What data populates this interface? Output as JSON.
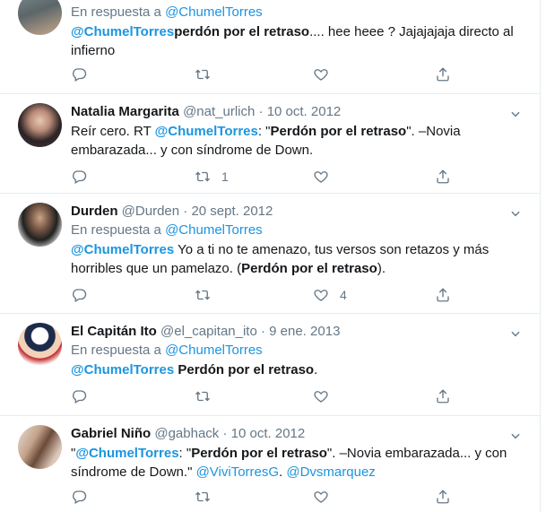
{
  "tweets": [
    {
      "reply_prefix": "En respuesta a",
      "reply_to": "@ChumelTorres",
      "mention": "@ChumelTorres",
      "bold_text": "perdón por el retraso",
      "rest": ".... hee heee ? Jajajajaja directo al infierno",
      "reply_count": "",
      "retweet_count": "",
      "like_count": ""
    },
    {
      "name": "Natalia Margarita",
      "handle": "@nat_urlich",
      "dot": "·",
      "date": "10 oct. 2012",
      "text_1": "Reír cero. RT ",
      "mention": "@ChumelTorres",
      "text_2": ": \"",
      "bold_text": "Perdón por el retraso",
      "text_3": "\". –Novia embarazada... y con síndrome de Down.",
      "reply_count": "",
      "retweet_count": "1",
      "like_count": ""
    },
    {
      "name": "Durden",
      "handle": "@Durden",
      "dot": "·",
      "date": "20 sept. 2012",
      "reply_prefix": "En respuesta a",
      "reply_to": "@ChumelTorres",
      "mention": "@ChumelTorres",
      "text_1": " Yo a ti no te amenazo, tus versos son retazos y más horribles que un pamelazo. (",
      "bold_text": "Perdón por el retraso",
      "text_2": ").",
      "reply_count": "",
      "retweet_count": "",
      "like_count": "4"
    },
    {
      "name": "El Capitán Ito",
      "handle": "@el_capitan_ito",
      "dot": "·",
      "date": "9 ene. 2013",
      "reply_prefix": "En respuesta a",
      "reply_to": "@ChumelTorres",
      "mention": "@ChumelTorres",
      "bold_text": " Perdón por el retraso",
      "text_1": ".",
      "reply_count": "",
      "retweet_count": "",
      "like_count": ""
    },
    {
      "name": "Gabriel Niño",
      "handle": "@gabhack",
      "dot": "·",
      "date": "10 oct. 2012",
      "text_0": "\"",
      "mention": "@ChumelTorres",
      "text_1": ": \"",
      "bold_text": "Perdón por el retraso",
      "text_2": "\". –Novia embarazada... y con síndrome de Down.\" ",
      "mention_2": "@ViviTorresG",
      "text_3": ". ",
      "mention_3": "@Dvsmarquez",
      "reply_count": "",
      "retweet_count": "",
      "like_count": ""
    }
  ],
  "colors": {
    "link": "#1b95e0",
    "muted": "#657786",
    "text": "#14171a",
    "border": "#e6ecf0"
  },
  "icons": [
    "reply-icon",
    "retweet-icon",
    "like-icon",
    "share-icon",
    "chevron-down-icon"
  ]
}
